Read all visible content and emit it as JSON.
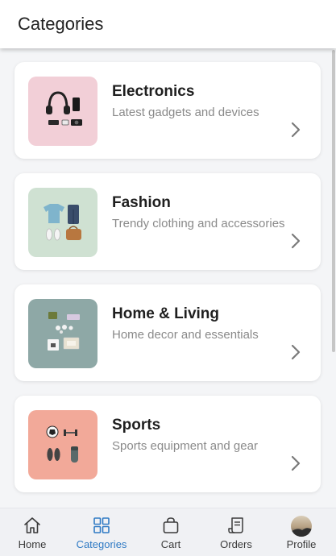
{
  "header": {
    "title": "Categories"
  },
  "categories": [
    {
      "title": "Electronics",
      "subtitle": "Latest gadgets and devices",
      "image_icon": "electronics-image"
    },
    {
      "title": "Fashion",
      "subtitle": "Trendy clothing and accessories",
      "image_icon": "fashion-image"
    },
    {
      "title": "Home & Living",
      "subtitle": "Home decor and essentials",
      "image_icon": "home-living-image"
    },
    {
      "title": "Sports",
      "subtitle": "Sports equipment and gear",
      "image_icon": "sports-image"
    }
  ],
  "nav": {
    "items": [
      {
        "label": "Home",
        "icon": "home-icon",
        "active": false
      },
      {
        "label": "Categories",
        "icon": "grid-icon",
        "active": true
      },
      {
        "label": "Cart",
        "icon": "bag-icon",
        "active": false
      },
      {
        "label": "Orders",
        "icon": "receipt-icon",
        "active": false
      },
      {
        "label": "Profile",
        "icon": "avatar",
        "active": false
      }
    ]
  },
  "colors": {
    "accent": "#2f7ac4",
    "background": "#f4f5f7",
    "card": "#ffffff",
    "electronics_bg": "#f2cfd7",
    "fashion_bg": "#cfe1d2",
    "home_bg": "#8ea8a6",
    "sports_bg": "#f2a999"
  }
}
